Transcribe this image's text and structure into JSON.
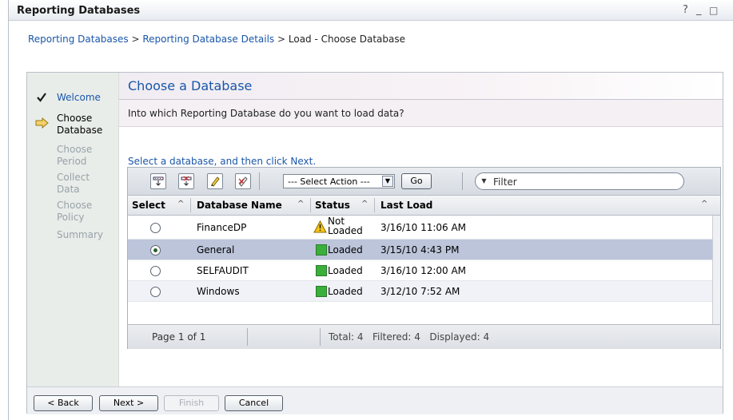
{
  "window": {
    "title": "Reporting Databases",
    "help": "?",
    "minimize": "_",
    "maximize": "□"
  },
  "breadcrumb": {
    "item1": "Reporting Databases",
    "sep1": " > ",
    "item2": "Reporting Database Details",
    "sep2": " > ",
    "current": "Load - Choose Database"
  },
  "steps": {
    "welcome": "Welcome",
    "choose_db": [
      "Choose",
      "Database"
    ],
    "choose_period": [
      "Choose",
      "Period"
    ],
    "collect_data": [
      "Collect",
      "Data"
    ],
    "choose_policy": [
      "Choose",
      "Policy"
    ],
    "summary": "Summary"
  },
  "content": {
    "title": "Choose a Database",
    "question": "Into which Reporting Database do you want to load data?",
    "instruction": "Select a database, and then click Next."
  },
  "toolbar": {
    "select_action": "--- Select Action ---",
    "go": "Go",
    "filter_placeholder": "Filter"
  },
  "table": {
    "headers": {
      "select": "Select",
      "name": "Database Name",
      "status": "Status",
      "last_load": "Last Load"
    },
    "rows": [
      {
        "name": "FinanceDP",
        "status": [
          "Not",
          "Loaded"
        ],
        "last_load": "3/16/10 11:06 AM",
        "selected": false
      },
      {
        "name": "General",
        "status": "Loaded",
        "last_load": "3/15/10 4:43 PM",
        "selected": true
      },
      {
        "name": "SELFAUDIT",
        "status": "Loaded",
        "last_load": "3/16/10 12:00 AM",
        "selected": false
      },
      {
        "name": "Windows",
        "status": "Loaded",
        "last_load": "3/12/10 7:52 AM",
        "selected": false
      }
    ],
    "footer": {
      "page": "Page 1 of 1",
      "totals": "Total: 4   Filtered: 4   Displayed: 4"
    }
  },
  "buttons": {
    "back": "< Back",
    "next": "Next >",
    "finish": "Finish",
    "cancel": "Cancel"
  }
}
